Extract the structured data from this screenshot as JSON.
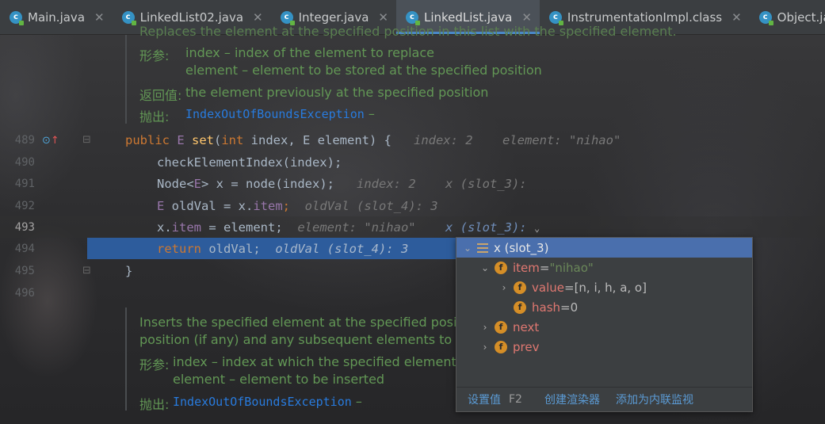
{
  "tabs": [
    {
      "label": "Main.java",
      "active": false
    },
    {
      "label": "LinkedList02.java",
      "active": false
    },
    {
      "label": "Integer.java",
      "active": false
    },
    {
      "label": "LinkedList.java",
      "active": true
    },
    {
      "label": "InstrumentationImpl.class",
      "active": false
    },
    {
      "label": "Object.java",
      "active": false
    }
  ],
  "doc_top": {
    "cut_line": "Replaces the element at the specified position in this list with the specified element.",
    "params_label": "形参:",
    "param1": "index – index of the element to replace",
    "param2": "element – element to be stored at the specified position",
    "returns_label": "返回值:",
    "returns": "the element previously at the specified position",
    "throws_label": "抛出:",
    "throws": "IndexOutOfBoundsException",
    "throws_dash": "–"
  },
  "line_numbers": [
    "489",
    "490",
    "491",
    "492",
    "493",
    "494",
    "495",
    "496"
  ],
  "code": {
    "l489_pub": "public ",
    "l489_e": "E ",
    "l489_set": "set",
    "l489_open": "(",
    "l489_int": "int ",
    "l489_rest": "index, E element) {",
    "l489_hint1": "index: 2",
    "l489_hint2": "element: \"nihao\"",
    "l490": "checkElementIndex(index);",
    "l491_a": "Node<",
    "l491_e": "E",
    "l491_b": "> x = node(index);",
    "l491_hint1": "index: 2",
    "l491_hint2": "x (slot_3):",
    "l492_e": "E ",
    "l492_a": "oldVal = x.",
    "l492_item": "item",
    "l492_semi": ";",
    "l492_hint": "oldVal (slot_4): 3",
    "l493_a": "x.",
    "l493_item": "item",
    "l493_b": " = element;",
    "l493_hint": "element: \"nihao\"",
    "l493_hint2": "x (slot_3):",
    "l494_ret": "return ",
    "l494_b": "oldVal;",
    "l494_hint": "oldVal (slot_4): 3",
    "l495": "}"
  },
  "doc_bottom": {
    "line1": "Inserts the specified element at the specified positio",
    "line2": "position (if any) and any subsequent elements to the",
    "params_label": "形参:",
    "param1": "index – index at which the specified element is",
    "param2": "element – element to be inserted",
    "throws_label": "抛出:",
    "throws": "IndexOutOfBoundsException",
    "throws_dash": "–"
  },
  "popup": {
    "root": "x (slot_3)",
    "item_name": "item",
    "item_eq": " = ",
    "item_val": "\"nihao\"",
    "value_name": "value",
    "value_eq": " = ",
    "value_val": "[n, i, h, a, o]",
    "hash_name": "hash",
    "hash_eq": " = ",
    "hash_val": "0",
    "next_name": "next",
    "prev_name": "prev",
    "footer_set": "设置值",
    "footer_key": "F2",
    "footer_renderer": "创建渲染器",
    "footer_watch": "添加为内联监视"
  },
  "colors": {
    "accent": "#4a88c7",
    "selection": "#2d5c9c",
    "field_icon": "#d58e27",
    "doc_comment": "#629755"
  }
}
